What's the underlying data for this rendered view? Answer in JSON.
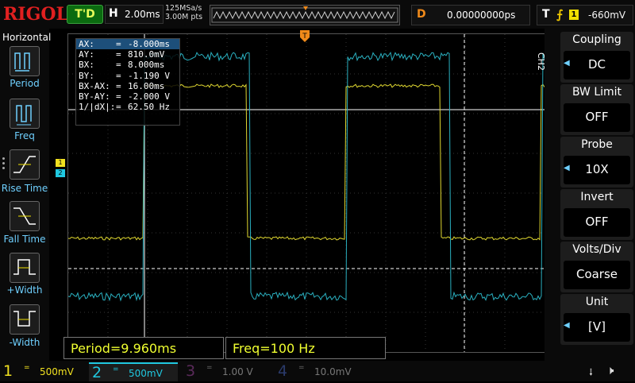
{
  "header": {
    "logo": "RIGOL",
    "run_state": "T'D",
    "horizontal_key": "H",
    "timebase": "2.00ms",
    "sample_rate": "125MSa/s",
    "memory_depth": "3.00M pts",
    "delay_key": "D",
    "delay_value": "0.00000000ps",
    "trigger_key": "T",
    "trigger_source": "1",
    "trigger_level": "-660mV"
  },
  "left_menu": {
    "title": "Horizontal",
    "items": [
      {
        "label": "Period",
        "icon": "period-icon"
      },
      {
        "label": "Freq",
        "icon": "freq-icon"
      },
      {
        "label": "Rise Time",
        "icon": "rise-time-icon"
      },
      {
        "label": "Fall Time",
        "icon": "fall-time-icon"
      },
      {
        "label": "+Width",
        "icon": "positive-width-icon"
      },
      {
        "label": "-Width",
        "icon": "negative-width-icon"
      }
    ]
  },
  "cursor_readout": [
    {
      "label": "AX:",
      "value": "-8.000ms"
    },
    {
      "label": "AY:",
      "value": "810.0mV"
    },
    {
      "label": "BX:",
      "value": "8.000ms"
    },
    {
      "label": "BY:",
      "value": "-1.190 V"
    },
    {
      "label": "BX-AX:",
      "value": "16.00ms"
    },
    {
      "label": "BY-AY:",
      "value": "-2.000 V"
    },
    {
      "label": "1/|dX|:",
      "value": "62.50 Hz"
    }
  ],
  "channel_markers": {
    "ch1": "1",
    "ch2": "2",
    "trigger": "T"
  },
  "right_menu": {
    "channel_label": "CH2",
    "items": [
      {
        "title": "Coupling",
        "value": "DC"
      },
      {
        "title": "BW Limit",
        "value": "OFF"
      },
      {
        "title": "Probe",
        "value": "10X"
      },
      {
        "title": "Invert",
        "value": "OFF"
      },
      {
        "title": "Volts/Div",
        "value": "Coarse"
      },
      {
        "title": "Unit",
        "value": "[V]"
      }
    ]
  },
  "measurements": {
    "period": "Period=9.960ms",
    "freq": "Freq=100 Hz"
  },
  "channels": [
    {
      "num": "1",
      "coupling": "=",
      "scale": "500mV",
      "color": "#f0e020"
    },
    {
      "num": "2",
      "coupling": "=",
      "scale": "500mV",
      "color": "#2ad0e0"
    },
    {
      "num": "3",
      "coupling": "=",
      "scale": "1.00 V",
      "color": "#c030c0"
    },
    {
      "num": "4",
      "coupling": "=",
      "scale": "10.0mV",
      "color": "#3060e0"
    }
  ],
  "colors": {
    "ch1": "#e8e028",
    "ch2": "#28b8c8",
    "accent": "#6fd0ff",
    "trigger": "#f08a1a"
  }
}
